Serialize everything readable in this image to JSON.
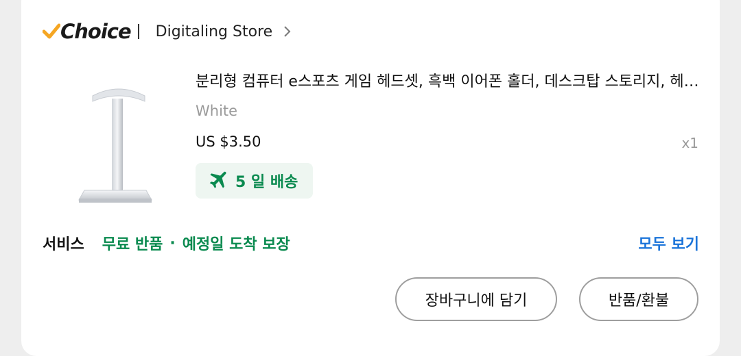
{
  "store": {
    "badge": "Choice",
    "name": "Digitaling Store"
  },
  "product": {
    "title": "분리형 컴퓨터 e스포츠 게임 헤드셋, 흑백 이어폰 홀더, 데스크탑 스토리지, 헤드폰 스탠드",
    "variant": "White",
    "price": "US $3.50",
    "quantity": "x1",
    "delivery": "5 일 배송",
    "image": "white headphone stand"
  },
  "service": {
    "label": "서비스",
    "items": [
      "무료 반품",
      "예정일 도착 보장"
    ],
    "separator": "·",
    "see_all": "모두 보기"
  },
  "actions": {
    "add_to_cart": "장바구니에 담기",
    "return_exchange": "반품/환불"
  },
  "colors": {
    "accent_green": "#0a8a4f",
    "link_blue": "#1a73d9",
    "choice_orange": "#f5a623"
  }
}
